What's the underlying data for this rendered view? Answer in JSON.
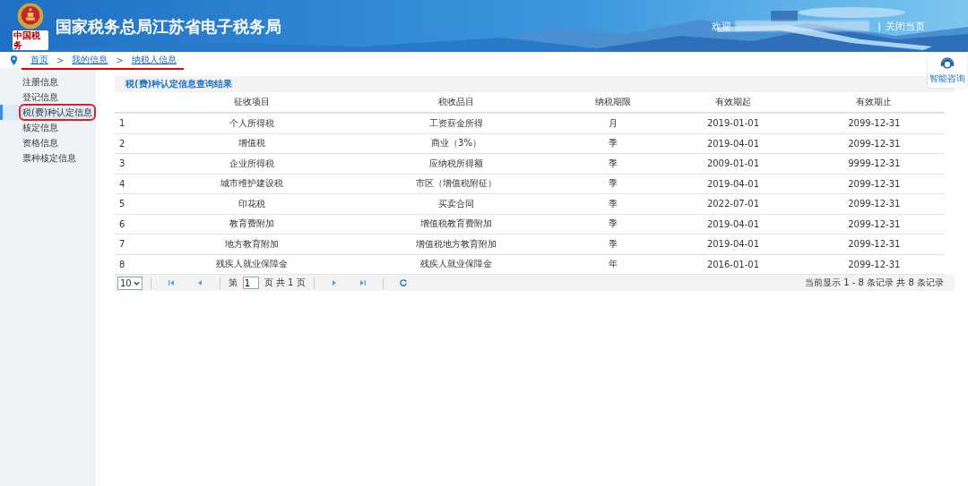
{
  "header": {
    "title": "国家税务总局江苏省电子税务局",
    "logo_caption": "中国税务",
    "welcome": "欢迎",
    "separator": "|",
    "close_link": "关闭当页"
  },
  "breadcrumb": [
    "首页",
    ">",
    "我的信息",
    ">",
    "纳税人信息"
  ],
  "assistant": {
    "label": "智能咨询"
  },
  "sidebar": {
    "items": [
      {
        "label": "注册信息",
        "selected": false
      },
      {
        "label": "登记信息",
        "selected": false
      },
      {
        "label": "税(费)种认定信息",
        "selected": true
      },
      {
        "label": "核定信息",
        "selected": false
      },
      {
        "label": "资格信息",
        "selected": false
      },
      {
        "label": "票种核定信息",
        "selected": false
      }
    ]
  },
  "panel": {
    "title": "税(费)种认定信息查询结果"
  },
  "table": {
    "columns": [
      "",
      "征收项目",
      "税收品目",
      "纳税期限",
      "有效期起",
      "有效期止"
    ],
    "rows": [
      [
        "1",
        "个人所得税",
        "工资薪金所得",
        "月",
        "2019-01-01",
        "2099-12-31"
      ],
      [
        "2",
        "增值税",
        "商业（3%）",
        "季",
        "2019-04-01",
        "2099-12-31"
      ],
      [
        "3",
        "企业所得税",
        "应纳税所得额",
        "季",
        "2009-01-01",
        "9999-12-31"
      ],
      [
        "4",
        "城市维护建设税",
        "市区（增值税附征）",
        "季",
        "2019-04-01",
        "2099-12-31"
      ],
      [
        "5",
        "印花税",
        "买卖合同",
        "季",
        "2022-07-01",
        "2099-12-31"
      ],
      [
        "6",
        "教育费附加",
        "增值税教育费附加",
        "季",
        "2019-04-01",
        "2099-12-31"
      ],
      [
        "7",
        "地方教育附加",
        "增值税地方教育附加",
        "季",
        "2019-04-01",
        "2099-12-31"
      ],
      [
        "8",
        "残疾人就业保障金",
        "残疾人就业保障金",
        "年",
        "2016-01-01",
        "2099-12-31"
      ]
    ]
  },
  "pager": {
    "page_size": "10",
    "page_prefix": "第",
    "page": "1",
    "page_suffix": "页 共 1 页",
    "summary": "当前显示 1 - 8 条记录 共 8 条记录"
  }
}
